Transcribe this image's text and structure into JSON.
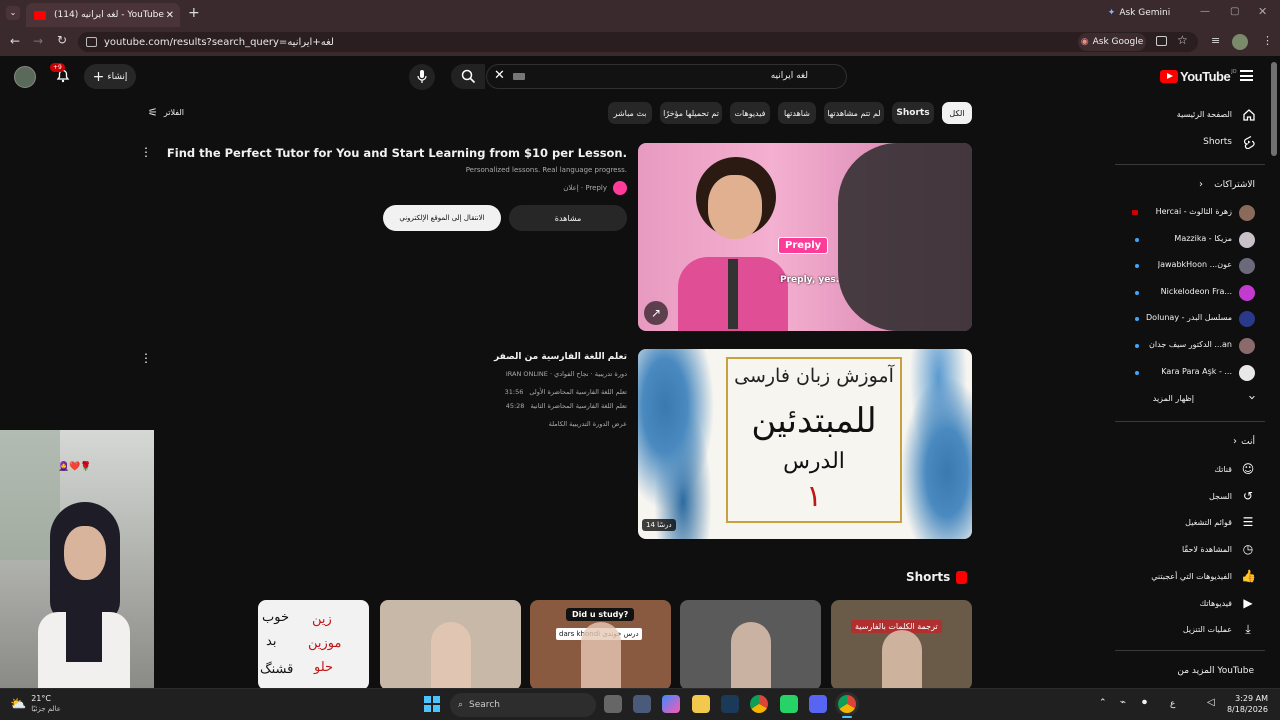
{
  "browser": {
    "tab_title": "(114) لغه ايرانيه - YouTube",
    "url": "youtube.com/results?search_query=لغه+ايرانيه",
    "ask_gemini": "Ask Gemini",
    "ask_google": "Ask Google"
  },
  "header": {
    "logo_text": "YouTube",
    "logo_country": "JO",
    "search_value": "لغه ايرانيه",
    "create_label": "إنشاء",
    "notif_count": "+9"
  },
  "filters": {
    "label": "الفلاتر",
    "chips": [
      "الكل",
      "Shorts",
      "لم تتم مشاهدتها",
      "شاهدتها",
      "فيديوهات",
      "تم تحميلها مؤخرًا",
      "بث مباشر"
    ]
  },
  "sidebar": {
    "home": "الصفحة الرئيسية",
    "shorts": "Shorts",
    "subs_title": "الاشتراكات",
    "subs": [
      {
        "name": "Hercai - زهرة الثالوث",
        "color": "#8a6a5a",
        "badge": "live"
      },
      {
        "name": "Mazzika - مزيكا",
        "color": "#c9c0c8",
        "badge": "dot"
      },
      {
        "name": "JawabkHoon ...عون",
        "color": "#6a6a7a",
        "badge": "dot"
      },
      {
        "name": "Nickelodeon Fra...",
        "color": "#c23ad0",
        "badge": "dot"
      },
      {
        "name": "Dolunay - مسلسل البدر",
        "color": "#2a3a8a",
        "badge": "dot"
      },
      {
        "name": "الدكتور سيف جدان ...an",
        "color": "#8a6a6a",
        "badge": "dot"
      },
      {
        "name": "Kara Para Aşk - ...",
        "color": "#e8e8e8",
        "badge": "dot"
      }
    ],
    "show_more": "إظهار المزيد",
    "you_title": "أنت",
    "you_items": [
      {
        "label": "قناتك",
        "icon": "your-channel-icon"
      },
      {
        "label": "السجل",
        "icon": "history-icon"
      },
      {
        "label": "قوائم التشغيل",
        "icon": "playlists-icon"
      },
      {
        "label": "المشاهدة لاحقًا",
        "icon": "watch-later-icon"
      },
      {
        "label": "الفيديوهات التي أعجبتني",
        "icon": "liked-icon"
      },
      {
        "label": "فيديوهاتك",
        "icon": "your-videos-icon"
      },
      {
        "label": "عمليات التنزيل",
        "icon": "downloads-icon"
      }
    ],
    "more_from": "المزيد من YouTube"
  },
  "ad": {
    "title": "Find the Perfect Tutor for You and Start Learning from $10 per Lesson.",
    "desc": "Personalized lessons. Real language progress.",
    "sponsor": "إعلان · Preply",
    "visit_btn": "الانتقال إلى الموقع الإلكتروني",
    "watch_btn": "مشاهدة",
    "thumb_brand": "Preply",
    "thumb_caption": "Preply, yes."
  },
  "course": {
    "title": "تعلم اللغة الفارسية من الصفر",
    "channel_line": "IRAN ONLINE · دورة تدريبية · نجاح الفوادي",
    "lesson1": "تعلم اللغة الفارسية المحاضرة الأولى",
    "lesson1_time": "31:56",
    "lesson2": "تعلم اللغة الفارسية المحاضرة الثانية",
    "lesson2_time": "45:28",
    "view_full": "عرض الدورة التدريبية الكاملة",
    "thumb_line1": "آموزش زبان فارسی",
    "thumb_line2": "للمبتدئين",
    "thumb_line3": "الدرس",
    "thumb_line4": "١",
    "lessons_badge": "14 درسًا"
  },
  "shorts": {
    "title": "Shorts",
    "items": [
      {
        "caption": "ترجمة الكلمات بالفارسية",
        "bg": "#6a5a48"
      },
      {
        "caption": "",
        "bg": "#5a5a5a"
      },
      {
        "caption": "Did u study?",
        "sub": "dars khondi درس خوندی",
        "bg": "#8a5a40"
      },
      {
        "caption": "",
        "bg": "#c8b8a8"
      },
      {
        "words": [
          "زين",
          "خوب",
          "موزين",
          "بد",
          "حلو",
          "قشنگ"
        ],
        "bg": "#f2f2f2"
      }
    ]
  },
  "pip": {
    "emoji": "🧕❤️🌹"
  },
  "taskbar": {
    "weather_temp": "21°C",
    "weather_desc": "عالم جزئيًا",
    "search": "Search",
    "time": "3:29 AM",
    "date": "8/18/2026",
    "lang": "ع"
  }
}
